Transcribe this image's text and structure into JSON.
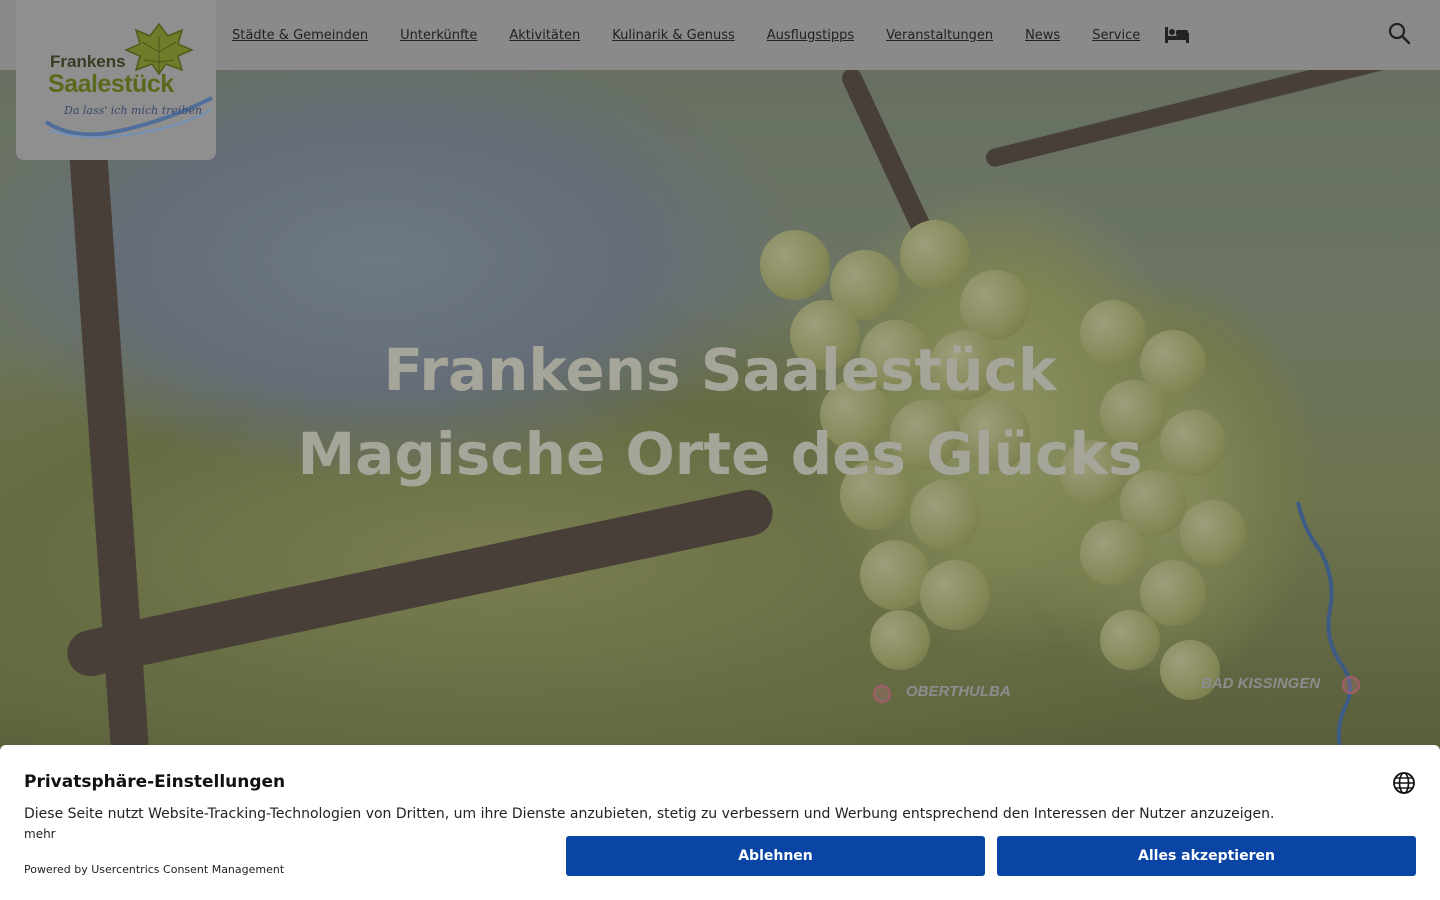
{
  "logo": {
    "line1": "Frankens",
    "line2": "Saalestück",
    "slogan": "Da lass' ich mich treiben"
  },
  "nav": {
    "items": [
      {
        "label": "Städte & Gemeinden"
      },
      {
        "label": "Unterkünfte"
      },
      {
        "label": "Aktivitäten"
      },
      {
        "label": "Kulinarik & Genuss"
      },
      {
        "label": "Ausflugstipps"
      },
      {
        "label": "Veranstaltungen"
      },
      {
        "label": "News"
      },
      {
        "label": "Service"
      }
    ],
    "icons": [
      "bed-icon",
      "search-icon"
    ]
  },
  "hero": {
    "title": "Frankens Saalestück",
    "subtitle": "Magische Orte des Glücks"
  },
  "map": {
    "labels": [
      "OBERTHULBA",
      "BAD KISSINGEN"
    ]
  },
  "consent": {
    "title": "Privatsphäre-Einstellungen",
    "text": "Diese Seite nutzt Website-Tracking-Technologien von Dritten, um ihre Dienste anzubieten, stetig zu verbessern und Werbung entsprechend den Interessen der Nutzer anzuzeigen.",
    "more": "mehr",
    "powered": "Powered by Usercentrics Consent Management",
    "deny_label": "Ablehnen",
    "accept_label": "Alles akzeptieren",
    "button_color": "#0a45a6"
  }
}
